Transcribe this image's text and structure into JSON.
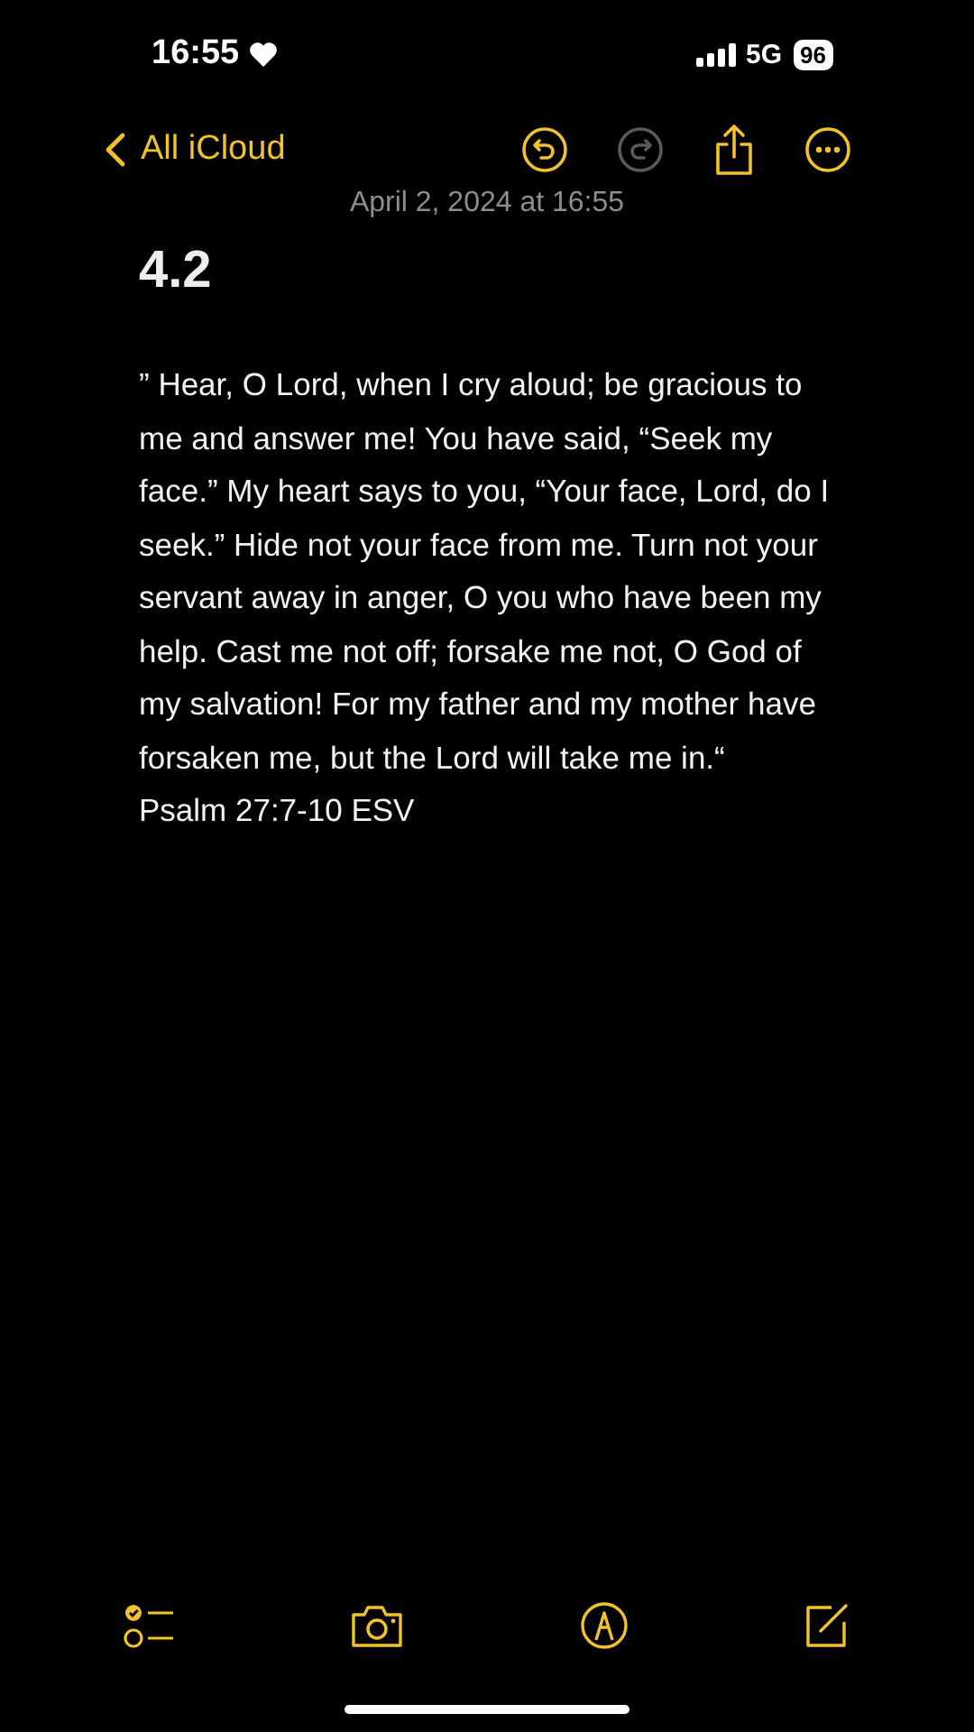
{
  "status_bar": {
    "time": "16:55",
    "network": "5G",
    "battery": "96"
  },
  "nav": {
    "back_label": "All iCloud",
    "undo": {
      "disabled": false
    },
    "redo": {
      "disabled": true
    }
  },
  "note": {
    "date": "April 2, 2024 at 16:55",
    "title": "4.2",
    "paragraphs": [
      "” Hear, O Lord, when I cry aloud; be gracious to me and answer me! You have said, “Seek my face.” My heart says to you, “Your face, Lord, do I seek.” Hide not your face from me. Turn not your servant away in anger, O you who have been my help. Cast me not off; forsake me not, O God of my salvation! For my father and my mother have forsaken me, but the Lord will take me in.“",
      "Psalm 27:7-10 ESV"
    ]
  }
}
